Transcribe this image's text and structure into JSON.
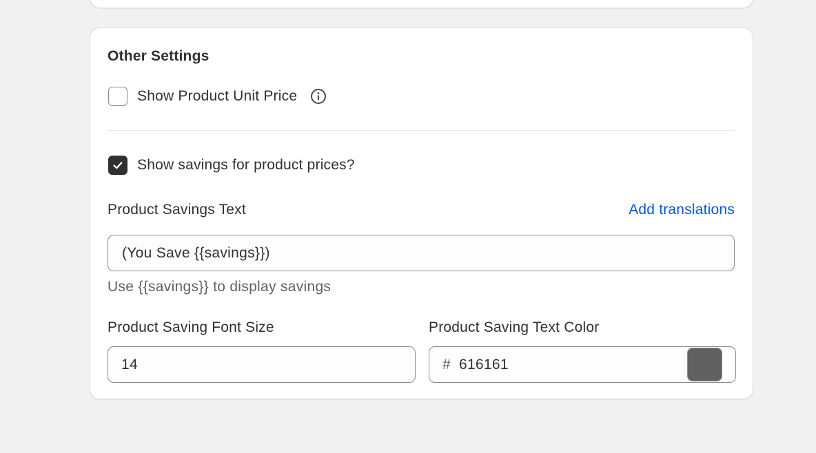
{
  "other_settings": {
    "title": "Other Settings",
    "unit_price": {
      "label": "Show Product Unit Price",
      "checked": false,
      "info_icon": "info-icon"
    },
    "savings": {
      "label": "Show savings for product prices?",
      "checked": true,
      "check_icon": "checkmark-icon"
    },
    "savings_text": {
      "label": "Product Savings Text",
      "add_translations": "Add translations",
      "value": "(You Save {{savings}})",
      "help": "Use {{savings}} to display savings"
    },
    "font_size": {
      "label": "Product Saving Font Size",
      "value": "14"
    },
    "text_color": {
      "label": "Product Saving Text Color",
      "prefix": "#",
      "value": "616161",
      "swatch_color": "#616161"
    }
  },
  "colors": {
    "link": "#005bd3",
    "text": "#303030",
    "muted": "#616161",
    "checked_bg": "#303030"
  }
}
